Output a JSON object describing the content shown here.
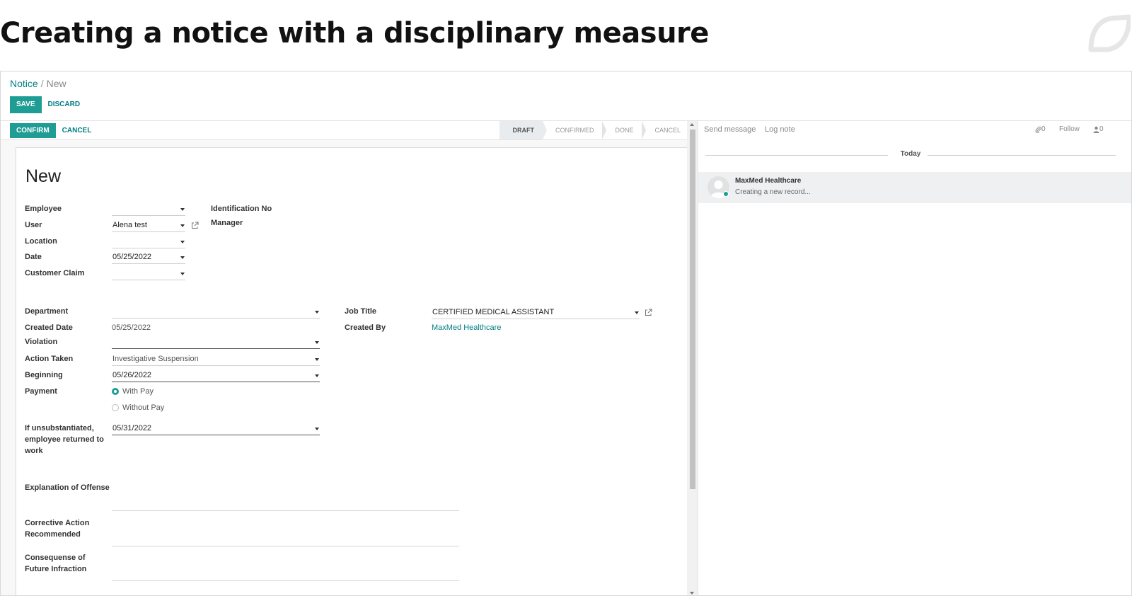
{
  "slide": {
    "title": "Creating a notice with a disciplinary measure"
  },
  "breadcrumb": {
    "parent": "Notice",
    "separator": "/",
    "current": "New"
  },
  "toolbar": {
    "save_label": "SAVE",
    "discard_label": "DISCARD"
  },
  "statusbar": {
    "confirm_label": "CONFIRM",
    "cancel_label": "CANCEL",
    "stages": [
      {
        "label": "DRAFT",
        "active": true
      },
      {
        "label": "CONFIRMED",
        "active": false
      },
      {
        "label": "DONE",
        "active": false
      },
      {
        "label": "CANCEL",
        "active": false
      }
    ]
  },
  "form": {
    "title": "New",
    "top_left": {
      "employee": {
        "label": "Employee",
        "value": ""
      },
      "user": {
        "label": "User",
        "value": "Alena test"
      },
      "location": {
        "label": "Location",
        "value": ""
      },
      "date": {
        "label": "Date",
        "value": "05/25/2022"
      },
      "customer_claim": {
        "label": "Customer Claim",
        "value": ""
      }
    },
    "top_right": {
      "identification_no": {
        "label": "Identification No"
      },
      "manager": {
        "label": "Manager"
      }
    },
    "mid_left": {
      "department": {
        "label": "Department",
        "value": ""
      },
      "created_date": {
        "label": "Created Date",
        "value": "05/25/2022"
      },
      "violation": {
        "label": "Violation",
        "value": ""
      },
      "action_taken": {
        "label": "Action Taken",
        "value": "Investigative Suspension"
      },
      "beginning": {
        "label": "Beginning",
        "value": "05/26/2022"
      },
      "payment": {
        "label": "Payment",
        "options": [
          "With Pay",
          "Without Pay"
        ],
        "selected": "With Pay"
      },
      "returned_to_work": {
        "label_line1": "If unsubstantiated,",
        "label_line2": "employee returned to",
        "label_line3": "work",
        "value": "05/31/2022"
      }
    },
    "mid_right": {
      "job_title": {
        "label": "Job Title",
        "value": "CERTIFIED MEDICAL ASSISTANT"
      },
      "created_by": {
        "label": "Created By",
        "value": "MaxMed Healthcare"
      }
    },
    "text_fields": {
      "explanation": {
        "label": "Explanation of Offense"
      },
      "corrective_line1": "Corrective Action",
      "corrective_line2": "Recommended",
      "consequence_line1": "Consequense of",
      "consequence_line2": "Future Infraction"
    }
  },
  "chatter": {
    "send_message": "Send message",
    "log_note": "Log note",
    "attachments_count": "0",
    "follow_label": "Follow",
    "followers_count": "0",
    "today_label": "Today",
    "message": {
      "author": "MaxMed Healthcare",
      "body": "Creating a new record..."
    }
  },
  "colors": {
    "primary": "#1f9d95",
    "link": "#017e84"
  }
}
